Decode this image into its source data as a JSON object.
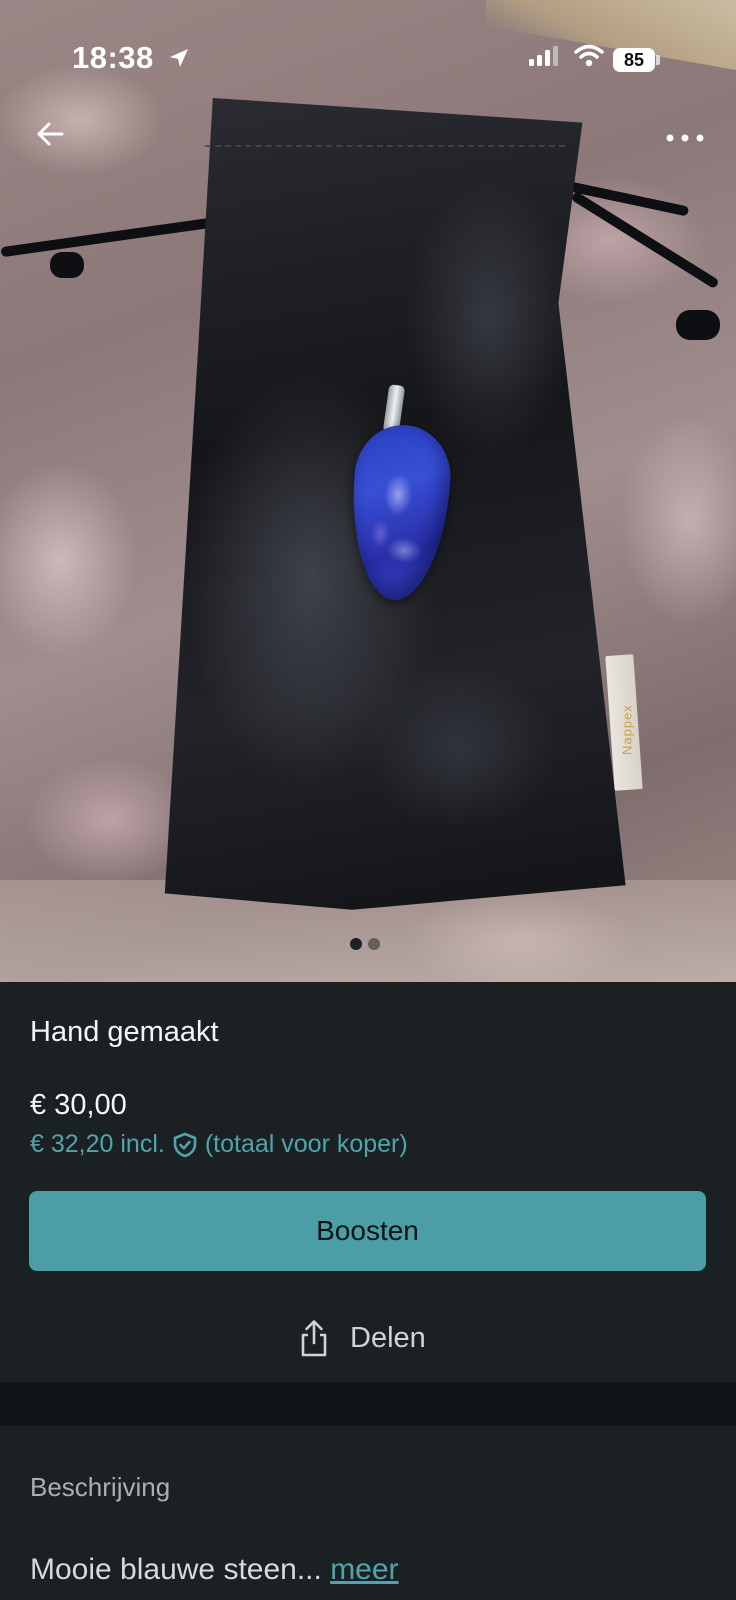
{
  "status_bar": {
    "time": "18:38",
    "battery": "85",
    "icons": [
      "location-arrow-icon",
      "signal-icon",
      "wifi-icon",
      "battery-icon"
    ]
  },
  "nav": {
    "back_icon": "arrow-left-icon",
    "more_icon": "more-horizontal-icon"
  },
  "photo": {
    "description_visible": "blue teardrop pendant on black satin pouch",
    "tag_text": "Nappex",
    "carousel": {
      "total": 2,
      "active": 1
    }
  },
  "listing": {
    "title": "Hand gemaakt",
    "price": "€ 30,00",
    "price_incl": "€ 32,20 incl.",
    "price_note": "(totaal voor koper)",
    "shield_icon": "shield-check-icon"
  },
  "actions": {
    "boost_label": "Boosten",
    "share_label": "Delen",
    "share_icon": "share-icon"
  },
  "description": {
    "heading": "Beschrijving",
    "text": "Mooie blauwe steen...",
    "more_label": "meer"
  },
  "colors": {
    "accent": "#4b9ea5",
    "link": "#4fa5ab",
    "background": "#1b2023",
    "divider": "#111517"
  }
}
